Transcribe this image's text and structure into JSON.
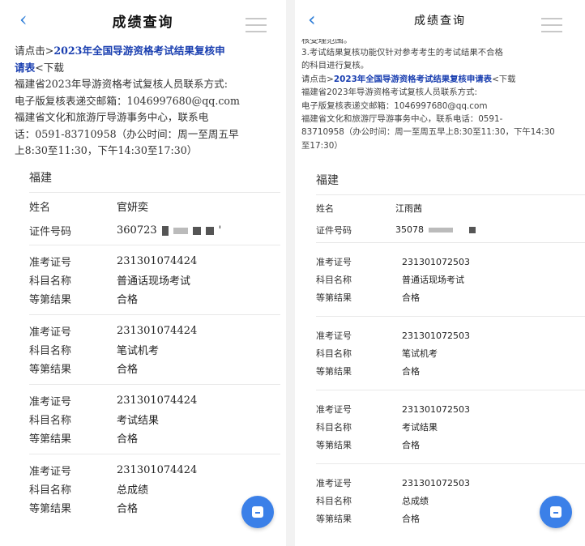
{
  "left": {
    "title": "成绩查询",
    "intro": {
      "line1_prefix": "请点击>",
      "line1_link": "2023年全国导游资格考试结果复核申",
      "line2_link": "请表",
      "line2_suffix": "<下载",
      "line3": "福建省2023年导游资格考试复核人员联系方式:",
      "line4": "电子版复核表递交邮箱：1046997680@qq.com",
      "line5": "福建省文化和旅游厅导游事务中心，联系电",
      "line6": "话：0591-83710958（办公时间：周一至周五早",
      "line7": "上8:30至11:30，下午14:30至17:30）"
    },
    "province": "福建",
    "name_label": "姓名",
    "name_value": "官妍奕",
    "id_label": "证件号码",
    "id_value": "360723",
    "id_tail": "'",
    "results": [
      {
        "ticket_label": "准考证号",
        "ticket": "231301074424",
        "subject_label": "科目名称",
        "subject": "普通话现场考试",
        "grade_label": "等第结果",
        "grade": "合格"
      },
      {
        "ticket_label": "准考证号",
        "ticket": "231301074424",
        "subject_label": "科目名称",
        "subject": "笔试机考",
        "grade_label": "等第结果",
        "grade": "合格"
      },
      {
        "ticket_label": "准考证号",
        "ticket": "231301074424",
        "subject_label": "科目名称",
        "subject": "考试结果",
        "grade_label": "等第结果",
        "grade": "合格"
      },
      {
        "ticket_label": "准考证号",
        "ticket": "231301074424",
        "subject_label": "科目名称",
        "subject": "总成绩",
        "grade_label": "等第结果",
        "grade": "合格"
      }
    ]
  },
  "right": {
    "title": "成绩查询",
    "intro": {
      "line0": "核受理范围。",
      "line1": "3.考试结果复核功能仅针对参考考生的考试结果不合格",
      "line2": "的科目进行复核。",
      "line3_prefix": "请点击>",
      "line3_link": "2023年全国导游资格考试结果复核申请表",
      "line3_suffix": "<下载",
      "line4": "福建省2023年导游资格考试复核人员联系方式:",
      "line5": "电子版复核表递交邮箱：1046997680@qq.com",
      "line6": "福建省文化和旅游厅导游事务中心，联系电话：0591-",
      "line7": "83710958（办公时间：周一至周五早上8:30至11:30，下午14:30",
      "line8": "至17:30）"
    },
    "province": "福建",
    "name_label": "姓名",
    "name_value": "江雨茜",
    "id_label": "证件号码",
    "id_value": "35078",
    "results": [
      {
        "ticket_label": "准考证号",
        "ticket": "231301072503",
        "subject_label": "科目名称",
        "subject": "普通话现场考试",
        "grade_label": "等第结果",
        "grade": "合格"
      },
      {
        "ticket_label": "准考证号",
        "ticket": "231301072503",
        "subject_label": "科目名称",
        "subject": "笔试机考",
        "grade_label": "等第结果",
        "grade": "合格"
      },
      {
        "ticket_label": "准考证号",
        "ticket": "231301072503",
        "subject_label": "科目名称",
        "subject": "考试结果",
        "grade_label": "等第结果",
        "grade": "合格"
      },
      {
        "ticket_label": "准考证号",
        "ticket": "231301072503",
        "subject_label": "科目名称",
        "subject": "总成绩",
        "grade_label": "等第结果",
        "grade": "合格"
      }
    ]
  },
  "icons": {
    "back": "chevron-left-icon",
    "menu": "hamburger-menu-icon",
    "fab": "feedback-icon"
  },
  "colors": {
    "accent": "#2f7ed8",
    "link": "#1a3fb0",
    "fab": "#3b80e8"
  }
}
